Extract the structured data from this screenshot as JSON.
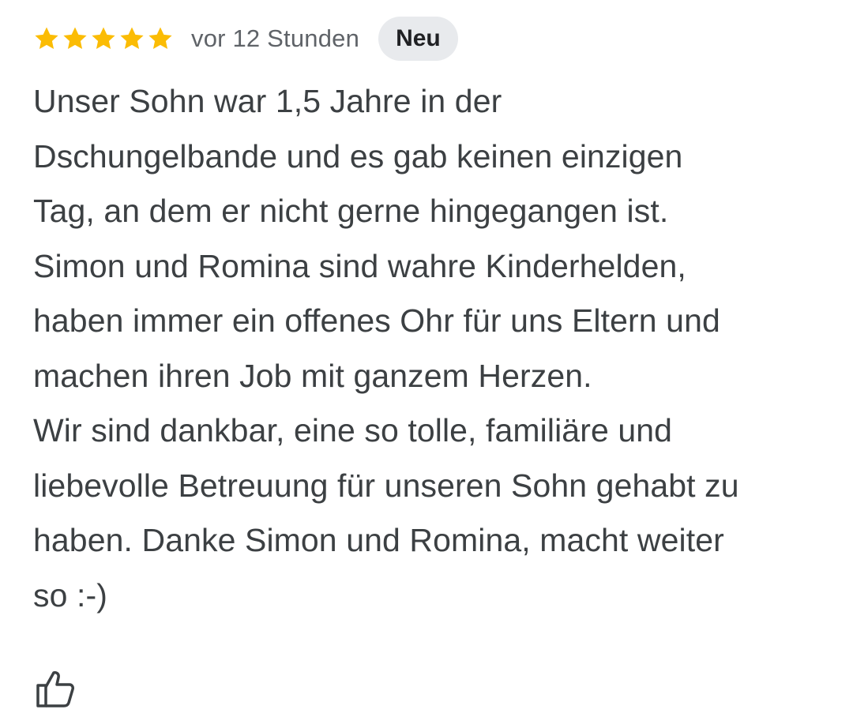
{
  "review": {
    "rating": 5,
    "rating_max": 5,
    "star_color": "#fbbc04",
    "time_label": "vor 12 Stunden",
    "badge_label": "Neu",
    "text": "Unser Sohn war 1,5 Jahre in der\nDschungelbande und es gab keinen einzigen\nTag, an dem er nicht gerne hingegangen ist.\nSimon und Romina sind wahre Kinderhelden,\nhaben immer ein offenes Ohr für uns Eltern und\nmachen ihren Job mit ganzem Herzen.\nWir sind dankbar, eine so tolle, familiäre und\nliebevolle Betreuung für unseren Sohn gehabt zu\nhaben. Danke Simon und Romina, macht weiter\nso :-)"
  },
  "actions": {
    "like_icon": "thumbs-up-icon"
  }
}
